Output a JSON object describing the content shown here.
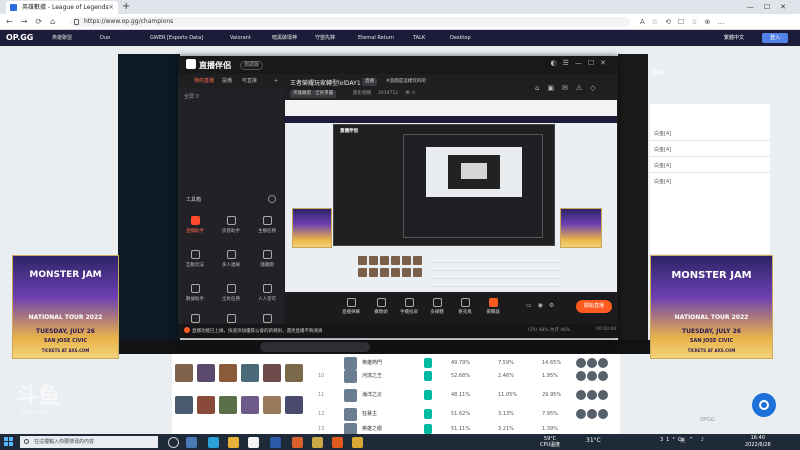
{
  "browser": {
    "tab_title": "英雄數據 - League of Legends",
    "tab_close": "×",
    "new_tab": "+",
    "url": "https://www.op.gg/champions",
    "nav_glyphs": "←→⟳⌂",
    "addr_glyphs": "A☆⟲☐☆⊕…",
    "win_glyphs": "—☐✕"
  },
  "opgg_nav": {
    "logo": "OP.GG",
    "sub": "英雄聯盟",
    "items": [
      "Duo",
      "GWER [Esports Data]",
      "Valorant",
      "暗黑破壞神",
      "守望先鋒",
      "Eternal Return",
      "TALK",
      "Desktop"
    ],
    "language": "繁體中文",
    "login": "登入"
  },
  "right_page": {
    "heading": "超神",
    "ranks": [
      "白金[4]",
      "白金[4]",
      "白金[4]",
      "白金[4]"
    ]
  },
  "banner": {
    "line1": "MONSTER JAM",
    "line2": "NATIONAL TOUR 2022",
    "date": "TUESDAY, JULY 26",
    "venue": "SAN JOSE CIVIC",
    "tickets": "TICKETS AT AXS.COM"
  },
  "app": {
    "name": "直播伴侶",
    "version": "測試版",
    "win_glyphs": "◐☰—☐✕",
    "nav": [
      "我的直播",
      "設備",
      "可直接",
      "+"
    ],
    "left_top": "全屏 0",
    "tools_header": "工具箱",
    "tools": [
      {
        "label": "直播助手",
        "active": true
      },
      {
        "label": "房管助手",
        "active": false
      },
      {
        "label": "主播任務",
        "active": false
      },
      {
        "label": "互動玩法",
        "active": false
      },
      {
        "label": "多人連線",
        "active": false
      },
      {
        "label": "隱藏圖",
        "active": false
      },
      {
        "label": "數據助手",
        "active": false
      },
      {
        "label": "全民任務",
        "active": false
      },
      {
        "label": "人人皆可",
        "active": false
      },
      {
        "label": "連麥",
        "active": false
      },
      {
        "label": "繪圖",
        "active": false
      },
      {
        "label": "更多",
        "active": false
      }
    ],
    "stream_title": "王者榮耀玩家轉型lolDAY1",
    "tag1": "直播",
    "tag2": "#遊戲是這樣玩的吧",
    "category": "英雄聯盟 · 全民爭霸",
    "history": "歷史相關",
    "room_id": "2019712",
    "viewers": "👁 0",
    "top_icons": "⌂▣✉⚠◇",
    "preview_title": "直播伴侶",
    "controls": [
      {
        "label": "直播彈幕"
      },
      {
        "label": "攝像頭"
      },
      {
        "label": "手機投屏"
      },
      {
        "label": "多媒體"
      },
      {
        "label": "麥克風"
      },
      {
        "label": "揚聲器"
      }
    ],
    "bar_icons": "▭◉⚙",
    "start_button": "開始直播",
    "notice": "直播功能已上線，快速添加優質公會的新規則，遇見直播不夠清爽",
    "sys_stats": "CPU 48%  內存 46%",
    "clock2": "00:00:00"
  },
  "table": {
    "rows": [
      {
        "rank": "",
        "name": "英雄熱門",
        "c1": "49.79%",
        "c2": "7.59%",
        "c3": "14.65%"
      },
      {
        "rank": "10",
        "name": "河流之王",
        "c1": "52.68%",
        "c2": "2.46%",
        "c3": "1.95%"
      },
      {
        "rank": "11",
        "name": "海洋之災",
        "c1": "48.11%",
        "c2": "11.05%",
        "c3": "29.95%"
      },
      {
        "rank": "12",
        "name": "狂暴主",
        "c1": "51.62%",
        "c2": "3.13%",
        "c3": "7.95%"
      },
      {
        "rank": "13",
        "name": "英雄之眼",
        "c1": "51.11%",
        "c2": "3.21%",
        "c3": "1.39%"
      }
    ]
  },
  "watermark": {
    "logo": "斗鱼",
    "sub": "douyu.com"
  },
  "chat": {
    "badge": "OPGG"
  },
  "taskbar": {
    "search_placeholder": "在這裡輸入你要搜尋的內容",
    "weather_temp": "59°C",
    "weather_label": "CPU溫度",
    "temp2": "31°C",
    "tray": "31°C ^ ♪",
    "ime": "英",
    "time": "16:40",
    "date": "2022/6/28"
  },
  "colors": {
    "accent": "#ff5a1f",
    "opgg_nav": "#1c1c3a",
    "opgg_login": "#5383e8",
    "tier": "#00bba3"
  }
}
